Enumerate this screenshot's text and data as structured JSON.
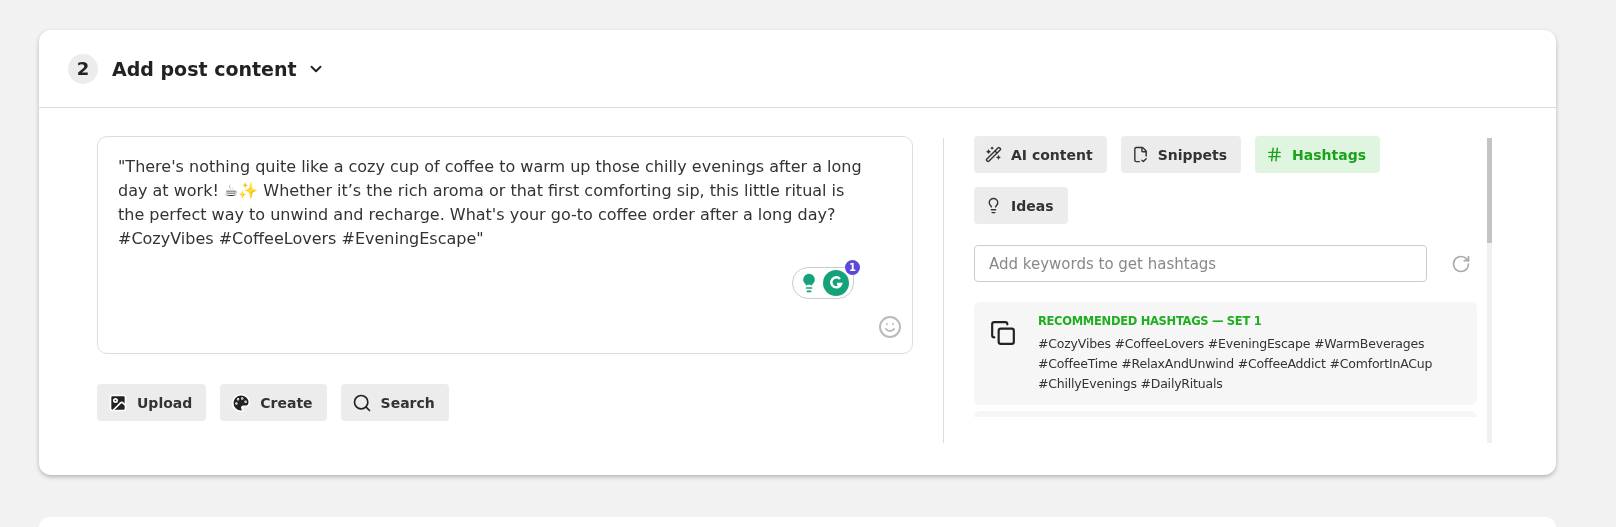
{
  "section": {
    "number": "2",
    "title": "Add post content",
    "expanded": true
  },
  "post": {
    "value": "\"There's nothing quite like a cozy cup of coffee to warm up those chilly evenings after a long day at work! ☕✨ Whether it’s the rich aroma or that first comforting sip, this little ritual is the perfect way to unwind and recharge. What's your go-to coffee order after a long day? #CozyVibes #CoffeeLovers #EveningEscape\"",
    "grammarly_count": "1"
  },
  "media_buttons": [
    {
      "kind": "upload",
      "label": "Upload"
    },
    {
      "kind": "create",
      "label": "Create"
    },
    {
      "kind": "search",
      "label": "Search"
    }
  ],
  "tabs": [
    {
      "kind": "ai",
      "label": "AI content",
      "selected": false
    },
    {
      "kind": "snippets",
      "label": "Snippets",
      "selected": false
    },
    {
      "kind": "hashtags",
      "label": "Hashtags",
      "selected": true
    },
    {
      "kind": "ideas",
      "label": "Ideas",
      "selected": false
    }
  ],
  "keyword_search": {
    "placeholder": "Add keywords to get hashtags"
  },
  "hashtag_sets": [
    {
      "title": "RECOMMENDED HASHTAGS — SET 1",
      "hashtags": "#CozyVibes #CoffeeLovers #EveningEscape #WarmBeverages #CoffeeTime #RelaxAndUnwind #CoffeeAddict #ComfortInACup #ChillyEvenings #DailyRituals"
    }
  ]
}
